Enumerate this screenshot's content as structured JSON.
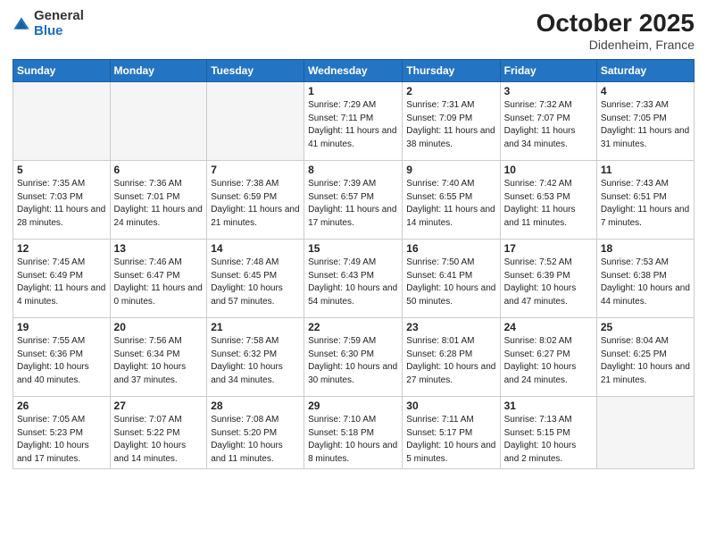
{
  "header": {
    "logo_general": "General",
    "logo_blue": "Blue",
    "title": "October 2025",
    "subtitle": "Didenheim, France"
  },
  "days_of_week": [
    "Sunday",
    "Monday",
    "Tuesday",
    "Wednesday",
    "Thursday",
    "Friday",
    "Saturday"
  ],
  "weeks": [
    [
      {
        "day": "",
        "info": ""
      },
      {
        "day": "",
        "info": ""
      },
      {
        "day": "",
        "info": ""
      },
      {
        "day": "1",
        "info": "Sunrise: 7:29 AM\nSunset: 7:11 PM\nDaylight: 11 hours and 41 minutes."
      },
      {
        "day": "2",
        "info": "Sunrise: 7:31 AM\nSunset: 7:09 PM\nDaylight: 11 hours and 38 minutes."
      },
      {
        "day": "3",
        "info": "Sunrise: 7:32 AM\nSunset: 7:07 PM\nDaylight: 11 hours and 34 minutes."
      },
      {
        "day": "4",
        "info": "Sunrise: 7:33 AM\nSunset: 7:05 PM\nDaylight: 11 hours and 31 minutes."
      }
    ],
    [
      {
        "day": "5",
        "info": "Sunrise: 7:35 AM\nSunset: 7:03 PM\nDaylight: 11 hours and 28 minutes."
      },
      {
        "day": "6",
        "info": "Sunrise: 7:36 AM\nSunset: 7:01 PM\nDaylight: 11 hours and 24 minutes."
      },
      {
        "day": "7",
        "info": "Sunrise: 7:38 AM\nSunset: 6:59 PM\nDaylight: 11 hours and 21 minutes."
      },
      {
        "day": "8",
        "info": "Sunrise: 7:39 AM\nSunset: 6:57 PM\nDaylight: 11 hours and 17 minutes."
      },
      {
        "day": "9",
        "info": "Sunrise: 7:40 AM\nSunset: 6:55 PM\nDaylight: 11 hours and 14 minutes."
      },
      {
        "day": "10",
        "info": "Sunrise: 7:42 AM\nSunset: 6:53 PM\nDaylight: 11 hours and 11 minutes."
      },
      {
        "day": "11",
        "info": "Sunrise: 7:43 AM\nSunset: 6:51 PM\nDaylight: 11 hours and 7 minutes."
      }
    ],
    [
      {
        "day": "12",
        "info": "Sunrise: 7:45 AM\nSunset: 6:49 PM\nDaylight: 11 hours and 4 minutes."
      },
      {
        "day": "13",
        "info": "Sunrise: 7:46 AM\nSunset: 6:47 PM\nDaylight: 11 hours and 0 minutes."
      },
      {
        "day": "14",
        "info": "Sunrise: 7:48 AM\nSunset: 6:45 PM\nDaylight: 10 hours and 57 minutes."
      },
      {
        "day": "15",
        "info": "Sunrise: 7:49 AM\nSunset: 6:43 PM\nDaylight: 10 hours and 54 minutes."
      },
      {
        "day": "16",
        "info": "Sunrise: 7:50 AM\nSunset: 6:41 PM\nDaylight: 10 hours and 50 minutes."
      },
      {
        "day": "17",
        "info": "Sunrise: 7:52 AM\nSunset: 6:39 PM\nDaylight: 10 hours and 47 minutes."
      },
      {
        "day": "18",
        "info": "Sunrise: 7:53 AM\nSunset: 6:38 PM\nDaylight: 10 hours and 44 minutes."
      }
    ],
    [
      {
        "day": "19",
        "info": "Sunrise: 7:55 AM\nSunset: 6:36 PM\nDaylight: 10 hours and 40 minutes."
      },
      {
        "day": "20",
        "info": "Sunrise: 7:56 AM\nSunset: 6:34 PM\nDaylight: 10 hours and 37 minutes."
      },
      {
        "day": "21",
        "info": "Sunrise: 7:58 AM\nSunset: 6:32 PM\nDaylight: 10 hours and 34 minutes."
      },
      {
        "day": "22",
        "info": "Sunrise: 7:59 AM\nSunset: 6:30 PM\nDaylight: 10 hours and 30 minutes."
      },
      {
        "day": "23",
        "info": "Sunrise: 8:01 AM\nSunset: 6:28 PM\nDaylight: 10 hours and 27 minutes."
      },
      {
        "day": "24",
        "info": "Sunrise: 8:02 AM\nSunset: 6:27 PM\nDaylight: 10 hours and 24 minutes."
      },
      {
        "day": "25",
        "info": "Sunrise: 8:04 AM\nSunset: 6:25 PM\nDaylight: 10 hours and 21 minutes."
      }
    ],
    [
      {
        "day": "26",
        "info": "Sunrise: 7:05 AM\nSunset: 5:23 PM\nDaylight: 10 hours and 17 minutes."
      },
      {
        "day": "27",
        "info": "Sunrise: 7:07 AM\nSunset: 5:22 PM\nDaylight: 10 hours and 14 minutes."
      },
      {
        "day": "28",
        "info": "Sunrise: 7:08 AM\nSunset: 5:20 PM\nDaylight: 10 hours and 11 minutes."
      },
      {
        "day": "29",
        "info": "Sunrise: 7:10 AM\nSunset: 5:18 PM\nDaylight: 10 hours and 8 minutes."
      },
      {
        "day": "30",
        "info": "Sunrise: 7:11 AM\nSunset: 5:17 PM\nDaylight: 10 hours and 5 minutes."
      },
      {
        "day": "31",
        "info": "Sunrise: 7:13 AM\nSunset: 5:15 PM\nDaylight: 10 hours and 2 minutes."
      },
      {
        "day": "",
        "info": ""
      }
    ]
  ]
}
